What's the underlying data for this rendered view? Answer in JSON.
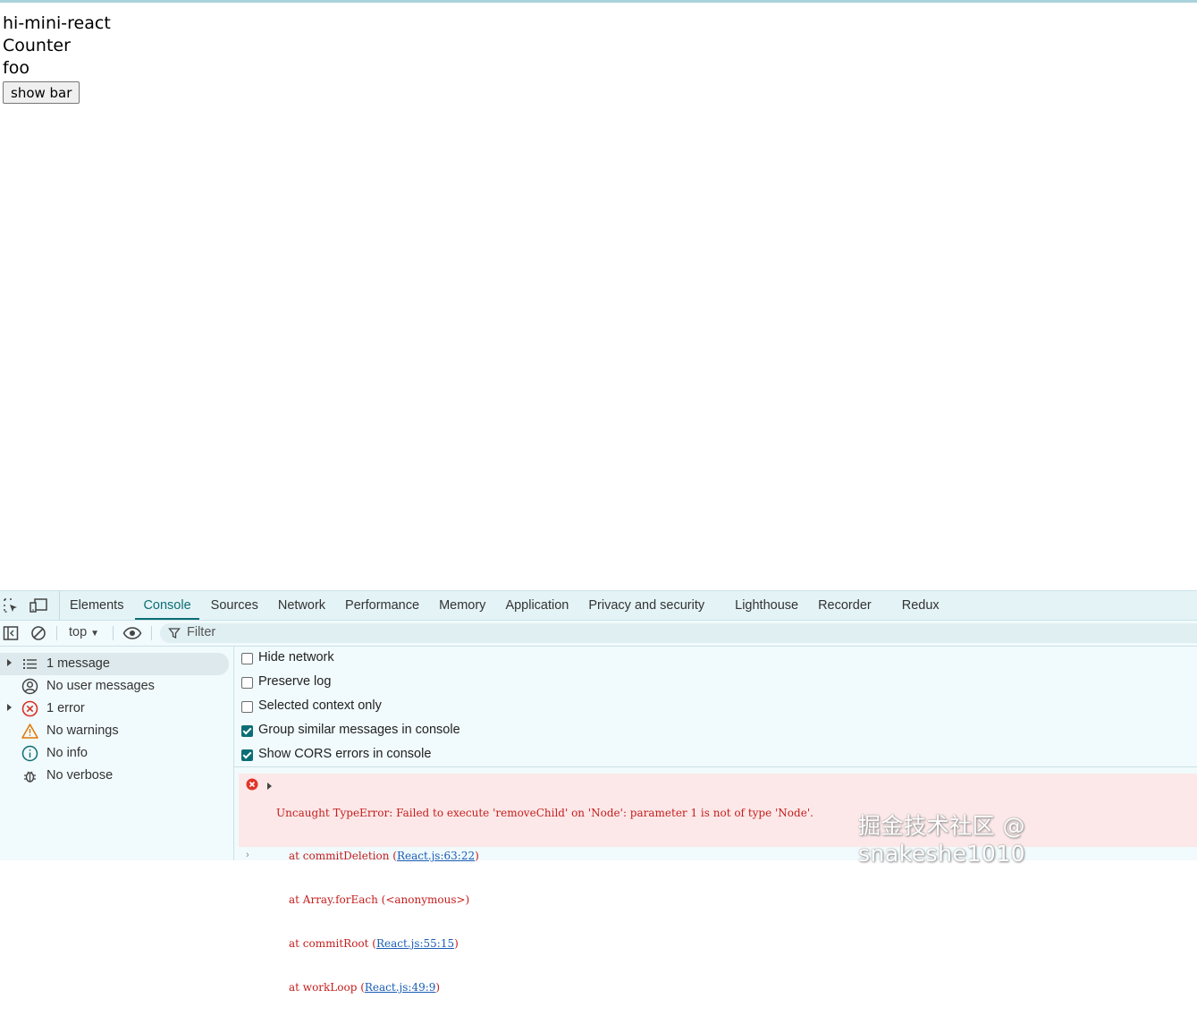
{
  "page": {
    "lines": [
      "hi-mini-react",
      "Counter",
      "foo"
    ],
    "button_label": "show bar"
  },
  "devtools": {
    "tabs": [
      "Elements",
      "Console",
      "Sources",
      "Network",
      "Performance",
      "Memory",
      "Application",
      "Privacy and security",
      "Lighthouse",
      "Recorder",
      "Redux"
    ],
    "active_tab": "Console",
    "context": "top",
    "filter_placeholder": "Filter",
    "sidebar": [
      {
        "label": "1 message",
        "icon": "list-icon"
      },
      {
        "label": "No user messages",
        "icon": "user-icon"
      },
      {
        "label": "1 error",
        "icon": "error-icon"
      },
      {
        "label": "No warnings",
        "icon": "warning-icon"
      },
      {
        "label": "No info",
        "icon": "info-icon"
      },
      {
        "label": "No verbose",
        "icon": "bug-icon"
      }
    ],
    "settings": [
      {
        "label": "Hide network",
        "checked": false
      },
      {
        "label": "Preserve log",
        "checked": false
      },
      {
        "label": "Selected context only",
        "checked": false
      },
      {
        "label": "Group similar messages in console",
        "checked": true
      },
      {
        "label": "Show CORS errors in console",
        "checked": true
      }
    ],
    "error": {
      "message": "Uncaught TypeError: Failed to execute 'removeChild' on 'Node': parameter 1 is not of type 'Node'.",
      "trace": [
        {
          "prefix": "at commitDeletion (",
          "link": "React.js:63:22",
          "suffix": ")"
        },
        {
          "prefix": "at Array.forEach (<anonymous>)",
          "link": "",
          "suffix": ""
        },
        {
          "prefix": "at commitRoot (",
          "link": "React.js:55:15",
          "suffix": ")"
        },
        {
          "prefix": "at workLoop (",
          "link": "React.js:49:9",
          "suffix": ")"
        }
      ]
    },
    "colors": {
      "accent": "#0b6e74",
      "error_bg": "#fce8e8",
      "error_text": "#c51d1d"
    }
  },
  "watermark": "掘金技术社区 @ snakeshe1010"
}
